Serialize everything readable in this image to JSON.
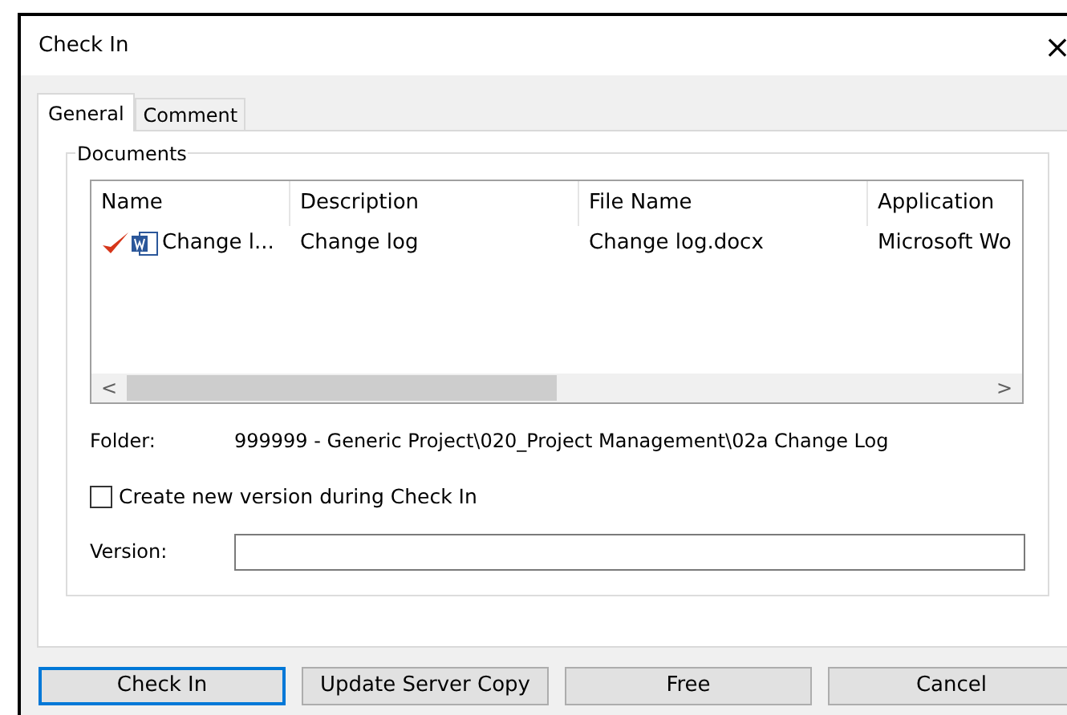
{
  "window": {
    "title": "Check In",
    "close": "×"
  },
  "tabs": [
    {
      "label": "General",
      "selected": true
    },
    {
      "label": "Comment",
      "selected": false
    }
  ],
  "documents": {
    "title": "Documents",
    "columns": [
      "Name",
      "Description",
      "File Name",
      "Application"
    ],
    "rows": [
      {
        "cells": [
          "Change l...",
          "Change log",
          "Change log.docx",
          "Microsoft Wo"
        ]
      }
    ],
    "scroll_left": "<",
    "scroll_right": ">"
  },
  "folder": {
    "label": "Folder:",
    "value": "999999 - Generic Project\\020_Project Management\\02a Change Log"
  },
  "create_version": {
    "label": "Create new version during Check In",
    "checked": false
  },
  "version": {
    "label": "Version:"
  },
  "buttons": [
    {
      "label": "Check In",
      "focused": true
    },
    {
      "label": "Update Server Copy",
      "focused": false
    },
    {
      "label": "Free",
      "focused": false
    },
    {
      "label": "Cancel",
      "focused": false
    }
  ]
}
